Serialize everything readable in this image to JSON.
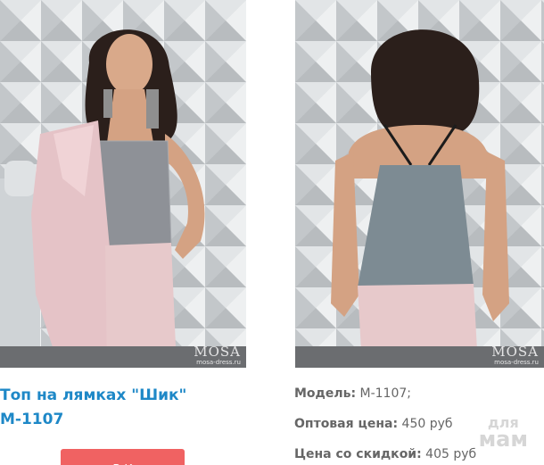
{
  "product": {
    "title_line1": "Топ на лямках \"Шик\"",
    "title_line2": "М-1107",
    "buy_label": "В К"
  },
  "photos": [
    {
      "watermark_logo": "MOSA",
      "watermark_url": "mosa-dress.ru"
    },
    {
      "watermark_logo": "MOSA",
      "watermark_url": "mosa-dress.ru"
    }
  ],
  "specs": [
    {
      "label": "Модель:",
      "value": "М-1107;"
    },
    {
      "label": "Оптовая цена:",
      "value": "450 руб"
    },
    {
      "label": "Цена со скидкой:",
      "value": "405 руб"
    }
  ],
  "site_watermark": {
    "line1": "для",
    "line2": "мам"
  },
  "colors": {
    "title": "#1e88c7",
    "buy_button": "#f06262",
    "spec_text": "#666666"
  }
}
